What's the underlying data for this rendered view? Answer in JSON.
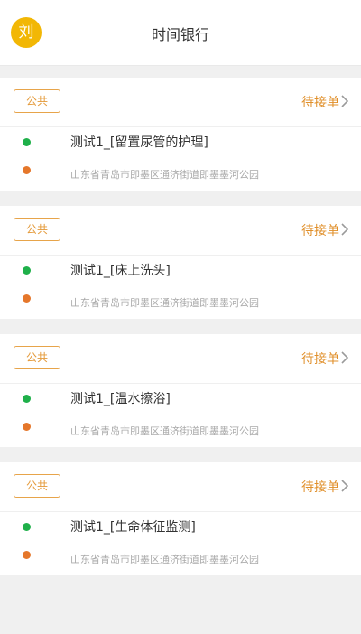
{
  "header": {
    "avatar_char": "刘",
    "title": "时间银行"
  },
  "colors": {
    "accent_orange": "#e08f2a",
    "avatar_yellow": "#f2b705",
    "dot_green": "#1fb04a",
    "dot_orange": "#e5772b"
  },
  "orders": [
    {
      "tag": "公共",
      "status": "待接单",
      "task": "测试1_[留置尿管的护理]",
      "address": "山东省青岛市即墨区通济街道即墨墨河公园"
    },
    {
      "tag": "公共",
      "status": "待接单",
      "task": "测试1_[床上洗头]",
      "address": "山东省青岛市即墨区通济街道即墨墨河公园"
    },
    {
      "tag": "公共",
      "status": "待接单",
      "task": "测试1_[温水擦浴]",
      "address": "山东省青岛市即墨区通济街道即墨墨河公园"
    },
    {
      "tag": "公共",
      "status": "待接单",
      "task": "测试1_[生命体征监测]",
      "address": "山东省青岛市即墨区通济街道即墨墨河公园"
    }
  ]
}
